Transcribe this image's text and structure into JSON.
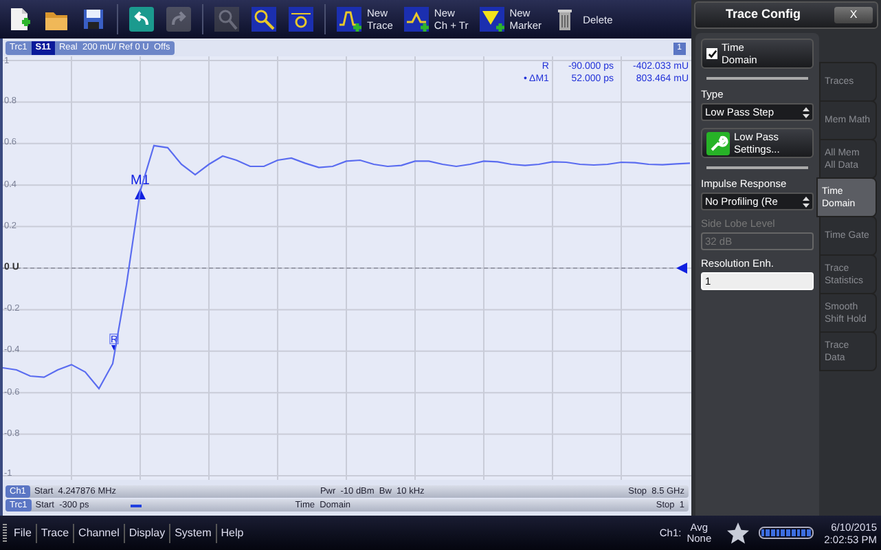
{
  "toolbar": [
    {
      "kind": "new-setup",
      "disabled": false
    },
    {
      "kind": "open",
      "disabled": false
    },
    {
      "kind": "save",
      "disabled": false
    },
    {
      "kind": "undo",
      "disabled": false
    },
    {
      "kind": "redo",
      "disabled": true
    },
    {
      "kind": "zoom-reset",
      "disabled": true
    },
    {
      "kind": "zoom",
      "disabled": false
    },
    {
      "kind": "zoom-marker",
      "disabled": false
    },
    {
      "kind": "new-trace",
      "label_lines": [
        "New",
        "Trace"
      ],
      "disabled": false
    },
    {
      "kind": "new-ch-tr",
      "label_lines": [
        "New",
        "Ch + Tr"
      ],
      "disabled": false
    },
    {
      "kind": "new-marker",
      "label_lines": [
        "New",
        "Marker"
      ],
      "disabled": false
    },
    {
      "kind": "delete",
      "label_lines": [
        "Delete"
      ],
      "disabled": false
    }
  ],
  "diagram": {
    "trace_label": "Trc1",
    "parameter": "S11",
    "scale": "Real  200 mU/ Ref 0 U  Offs",
    "window_number": "1",
    "marker_info": [
      {
        "name": "R",
        "x": "-90.000 ps",
        "y": "-402.033 mU"
      },
      {
        "name": "• ΔM1",
        "x": "52.000 ps",
        "y": "803.464 mU"
      }
    ],
    "chart_data": {
      "type": "line",
      "ylim": [
        -1,
        1
      ],
      "grid": true,
      "ref_lines": [
        {
          "axis": "y",
          "value": 0
        }
      ],
      "yticks": [
        {
          "value": 1,
          "label": "1"
        },
        {
          "value": 0.8,
          "label": "0.8"
        },
        {
          "value": 0.6,
          "label": "0.6"
        },
        {
          "value": 0.4,
          "label": "0.4"
        },
        {
          "value": 0.2,
          "label": "0.2"
        },
        {
          "value": 0,
          "label": "0 U"
        },
        {
          "value": -0.2,
          "label": "-0.2"
        },
        {
          "value": -0.4,
          "label": "-0.4"
        },
        {
          "value": -0.6,
          "label": "-0.6"
        },
        {
          "value": -0.8,
          "label": "-0.8"
        },
        {
          "value": -1,
          "label": "-1"
        }
      ],
      "categories": [
        null,
        null,
        null,
        null,
        null,
        null,
        null,
        null,
        null,
        null,
        null,
        null,
        null,
        null,
        null,
        null,
        null,
        null,
        null,
        null,
        null,
        null,
        null,
        null,
        null,
        null,
        null,
        null,
        null,
        null,
        null,
        null,
        null,
        null,
        null,
        null,
        null,
        null,
        null,
        null,
        null,
        null,
        null,
        null,
        null,
        null,
        null,
        null,
        null,
        null,
        null
      ],
      "series": [
        {
          "color": "#5a6cf0",
          "values": [
            -0.48,
            -0.49,
            -0.52,
            -0.525,
            -0.49,
            -0.465,
            -0.5,
            -0.58,
            -0.46,
            -0.08,
            0.37,
            0.59,
            0.58,
            0.5,
            0.45,
            0.5,
            0.54,
            0.52,
            0.49,
            0.49,
            0.52,
            0.53,
            0.505,
            0.485,
            0.49,
            0.515,
            0.52,
            0.5,
            0.49,
            0.495,
            0.515,
            0.515,
            0.5,
            0.49,
            0.5,
            0.515,
            0.512,
            0.5,
            0.495,
            0.5,
            0.512,
            0.51,
            0.5,
            0.497,
            0.5,
            0.51,
            0.508,
            0.5,
            0.498,
            0.502,
            0.505
          ]
        }
      ]
    },
    "markers": [
      {
        "kind": "reference",
        "label": "R"
      },
      {
        "kind": "delta",
        "label": "M1"
      }
    ]
  },
  "channel_bar": {
    "channel": "Ch1",
    "start": "Start  4.247876 MHz",
    "power": "Pwr  -10 dBm  Bw  10 kHz",
    "stop": "Stop  8.5 GHz"
  },
  "trace_bar": {
    "trace": "Trc1",
    "start": "Start  -300 ps",
    "mode": "Time  Domain",
    "stop": "Stop  1"
  },
  "panel": {
    "title": "Trace Config",
    "close": "X",
    "time_domain": {
      "label": "Time Domain",
      "checked": true
    },
    "type": {
      "label": "Type",
      "value": "Low Pass Step"
    },
    "settings_button": "Low Pass Settings...",
    "impulse": {
      "label": "Impulse Response",
      "value": "No Profiling (Re"
    },
    "side_lobe": {
      "label": "Side Lobe Level",
      "value": "32 dB",
      "disabled": true
    },
    "resolution": {
      "label": "Resolution Enh.",
      "value": "1",
      "disabled": false
    },
    "tabs": [
      {
        "label": "Traces",
        "selected": false
      },
      {
        "label": "Mem Math",
        "selected": false
      },
      {
        "label": "All Mem All Data",
        "selected": false
      },
      {
        "label": "Time Domain",
        "selected": true
      },
      {
        "label": "Time Gate",
        "selected": false
      },
      {
        "label": "Trace Statistics",
        "selected": false
      },
      {
        "label": "Smooth Shift Hold",
        "selected": false
      },
      {
        "label": "Trace Data",
        "selected": false
      }
    ]
  },
  "menu": [
    "File",
    "Trace",
    "Channel",
    "Display",
    "System",
    "Help"
  ],
  "status": {
    "channel": "Ch1:",
    "avg_label": "Avg",
    "avg_value": "None",
    "date": "6/10/2015",
    "time": "2:02:53 PM"
  }
}
